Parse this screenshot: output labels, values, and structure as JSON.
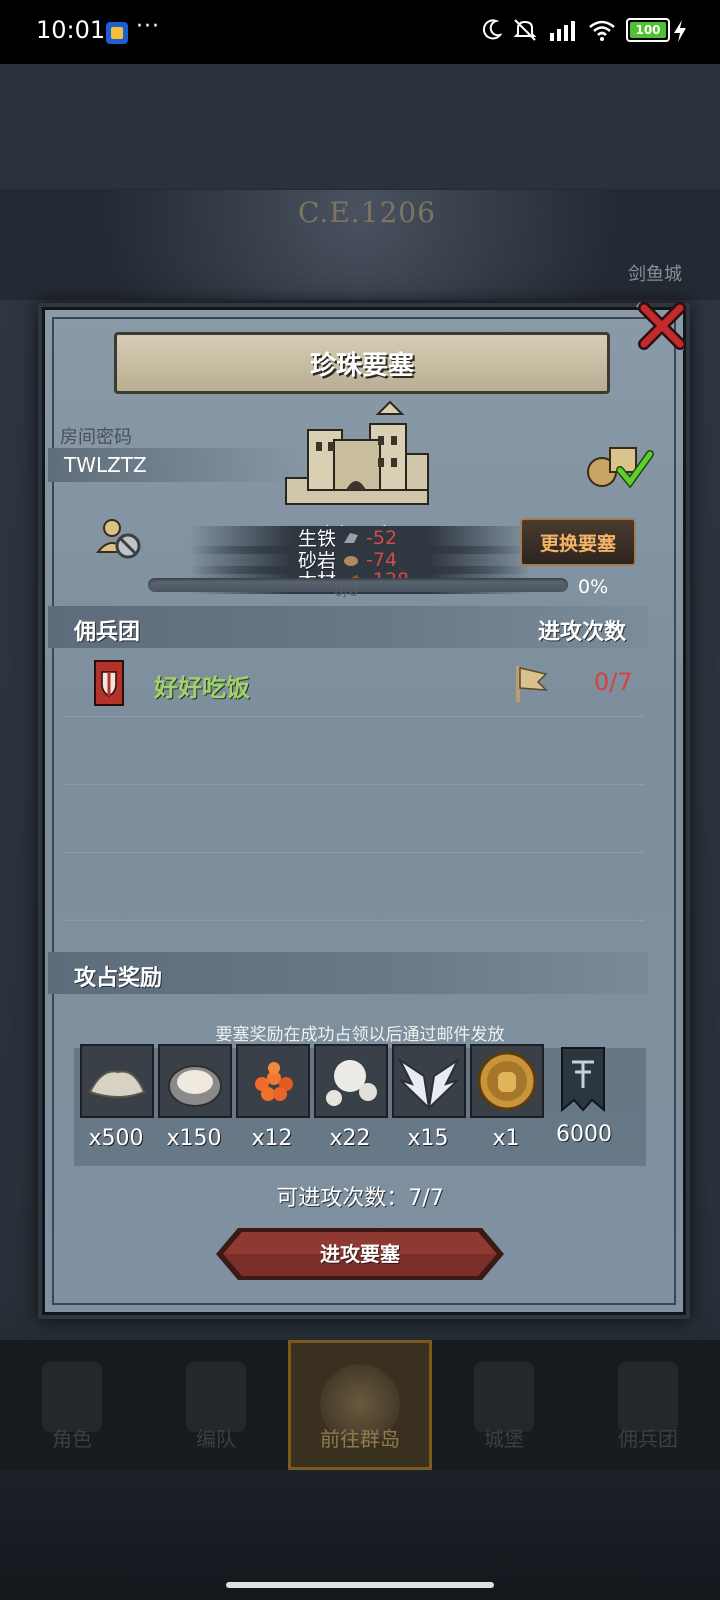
{
  "status_bar": {
    "time": "10:01",
    "dots": "···",
    "battery": "100"
  },
  "background": {
    "era": "C.E.1206",
    "city": "剑鱼城"
  },
  "dialog": {
    "title": "珍珠要塞",
    "room_code_label": "房间密码",
    "room_code": "TWLZTZ",
    "fortress_name": "高级要塞",
    "change_button": "更换要塞",
    "resources": [
      {
        "name": "生铁",
        "value": "-52",
        "icon": "iron-icon"
      },
      {
        "name": "砂岩",
        "value": "-74",
        "icon": "sandstone-icon"
      },
      {
        "name": "木材",
        "value": "-128",
        "icon": "wood-icon"
      }
    ],
    "occupy_time": "攻占时间 40小时",
    "progress": {
      "count": "0/0",
      "percent_text": "0%",
      "fraction": 0
    },
    "mercenary_header": "佣兵团",
    "attack_header": "进攻次数",
    "guilds": [
      {
        "name": "好好吃饭",
        "attacks": "0/7"
      }
    ],
    "reward_header": "攻占奖励",
    "reward_note": "要塞奖励在成功占领以后通过邮件发放",
    "rewards": [
      {
        "icon": "sand-pile-icon",
        "qty": "x500"
      },
      {
        "icon": "oyster-icon",
        "qty": "x150"
      },
      {
        "icon": "fish-roe-icon",
        "qty": "x12"
      },
      {
        "icon": "pearl-icon",
        "qty": "x22"
      },
      {
        "icon": "wing-emblem-icon",
        "qty": "x15"
      },
      {
        "icon": "knight-coin-icon",
        "qty": "x1"
      },
      {
        "icon": "guild-banner-icon",
        "qty": "6000"
      }
    ],
    "attacks_left": "可进攻次数：7/7",
    "attack_button": "进攻要塞"
  },
  "bottom_nav": [
    {
      "label": "角色",
      "icon": "knight-icon"
    },
    {
      "label": "编队",
      "icon": "helmet-icon"
    },
    {
      "label": "前往群岛",
      "icon": "compass-icon",
      "active": true
    },
    {
      "label": "城堡",
      "icon": "castle-icon"
    },
    {
      "label": "佣兵团",
      "icon": "banner-icon"
    }
  ],
  "colors": {
    "guild_name": "#9fd36a",
    "negative": "#d24b45",
    "attack_count": "#d4433d",
    "change_button_text": "#f3b466"
  }
}
